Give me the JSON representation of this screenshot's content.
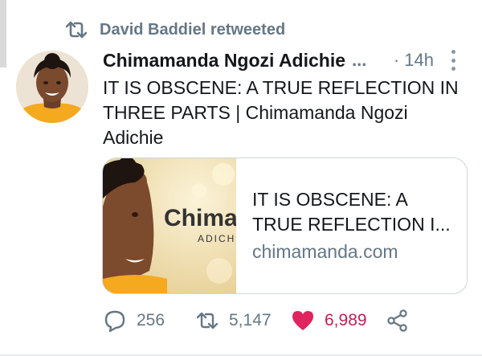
{
  "retweet": {
    "text": "David Baddiel retweeted"
  },
  "tweet": {
    "author": "Chimamanda Ngozi Adichie",
    "ellipsis": "...",
    "time": "· 14h",
    "text": "IT IS OBSCENE: A TRUE REFLECTION IN THREE PARTS | Chimamanda Ngozi Adichie"
  },
  "card": {
    "image_text": "Chimamanda",
    "image_subtext": "ADICHIE",
    "title": "IT IS OBSCENE: A TRUE REFLECTION I...",
    "domain": "chimamanda.com"
  },
  "actions": {
    "replies": "256",
    "retweets": "5,147",
    "likes": "6,989"
  },
  "colors": {
    "text": "#14171a",
    "muted": "#657786",
    "like": "#e0245e",
    "like_count": "#c51e55",
    "border": "#ccd6dd"
  },
  "icons": [
    "retweet-icon",
    "more-icon",
    "reply-icon",
    "retweet-icon",
    "heart-icon",
    "share-icon"
  ]
}
